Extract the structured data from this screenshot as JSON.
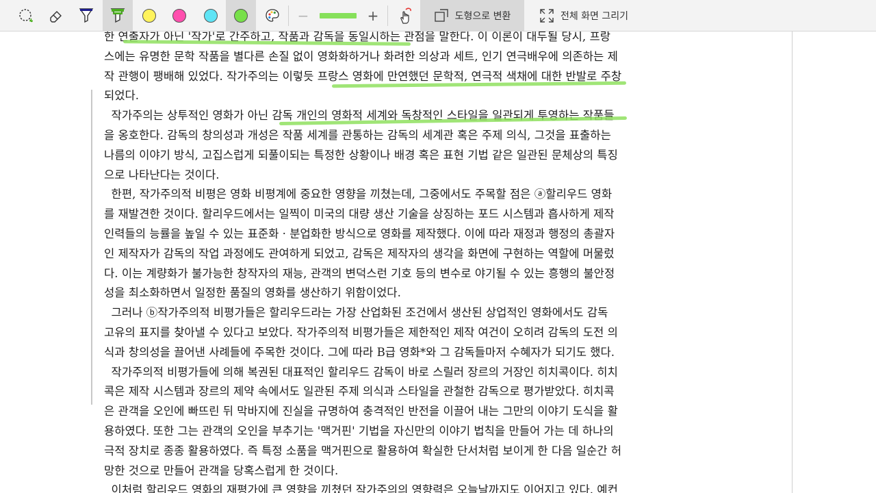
{
  "toolbar": {
    "tools": [
      {
        "name": "lasso-select-icon",
        "active": false
      },
      {
        "name": "eraser-icon",
        "active": false
      },
      {
        "name": "pen-icon",
        "color": "#1d1d8f",
        "active": false
      },
      {
        "name": "highlighter-icon",
        "color": "#4caf1f",
        "active": true
      }
    ],
    "swatches": [
      {
        "name": "yellow",
        "color": "#fff35c"
      },
      {
        "name": "pink",
        "color": "#ff4fae"
      },
      {
        "name": "cyan",
        "color": "#5fe4f5"
      },
      {
        "name": "green",
        "color": "#78e04a",
        "selected": true
      }
    ],
    "thickness_minus": "−",
    "thickness_plus": "+",
    "convert_to_shape_label": "도형으로 변환",
    "fullscreen_draw_label": "전체 화면 그리기"
  },
  "highlight_color": "#8fe05f",
  "document": {
    "lines": [
      "한 연출자가 아닌 '작가'로 간주하고, 작품과 감독을 동일시하는 관점을 말한다. 이 이론이 대두될 당시, 프랑",
      "스에는 유명한 문학 작품을 별다른 손질 없이 영화화하거나 화려한 의상과 세트, 인기 연극배우에 의존하는 제",
      "작 관행이 팽배해 있었다. 작가주의는 이렇듯 프랑스 영화에 만연했던 문학적, 연극적 색채에 대한 반발로 주창",
      "되었다.",
      "  작가주의는 상투적인 영화가 아닌 감독 개인의 영화적 세계와 독창적인 스타일을 일관되게 투영하는 작품들",
      "을 옹호한다. 감독의 창의성과 개성은 작품 세계를 관통하는 감독의 세계관 혹은 주제 의식, 그것을 표출하는",
      "나름의 이야기 방식, 고집스럽게 되풀이되는 특정한 상황이나 배경 혹은 표현 기법 같은 일관된 문체상의 특징",
      "으로 나타난다는 것이다.",
      "  한편, 작가주의적 비평은 영화 비평계에 중요한 영향을 끼쳤는데, 그중에서도 주목할 점은 ⓐ할리우드 영화",
      "를 재발견한 것이다. 할리우드에서는 일찍이 미국의 대량 생산 기술을 상징하는 포드 시스템과 흡사하게 제작",
      "인력들의 능률을 높일 수 있는 표준화 · 분업화한 방식으로 영화를 제작했다. 이에 따라 재정과 행정의 총괄자",
      "인 제작자가 감독의 작업 과정에도 관여하게 되었고, 감독은 제작자의 생각을 화면에 구현하는 역할에 머물렀",
      "다. 이는 계량화가 불가능한 창작자의 재능, 관객의 변덕스런 기호 등의 변수로 야기될 수 있는 흥행의 불안정",
      "성을 최소화하면서 일정한 품질의 영화를 생산하기 위함이었다.",
      "  그러나 ⓑ작가주의적 비평가들은 할리우드라는 가장 산업화된 조건에서 생산된 상업적인 영화에서도 감독",
      "고유의 표지를 찾아낼 수 있다고 보았다. 작가주의적 비평가들은 제한적인 제작 여건이 오히려 감독의 도전 의",
      "식과 창의성을 끌어낸 사례들에 주목한 것이다. 그에 따라 B급 영화*와 그 감독들마저 수혜자가 되기도 했다.",
      "  작가주의적 비평가들에 의해 복권된 대표적인 할리우드 감독이 바로 스릴러 장르의 거장인 히치콕이다. 히치",
      "콕은 제작 시스템과 장르의 제약 속에서도 일관된 주제 의식과 스타일을 관철한 감독으로 평가받았다. 히치콕",
      "은 관객을 오인에 빠뜨린 뒤 막바지에 진실을 규명하여 충격적인 반전을 이끌어 내는 그만의 이야기 도식을 활",
      "용하였다. 또한 그는 관객의 오인을 부추기는 '맥거핀' 기법을 자신만의 이야기 법칙을 만들어 가는 데 하나의",
      "극적 장치로 종종 활용하였다. 즉 특정 소품을 맥거핀으로 활용하여 확실한 단서처럼 보이게 한 다음 일순간 허",
      "망한 것으로 만들어 관객을 당혹스럽게 한 것이다.",
      "  이처럼 할리우드 영화의 재평가에 큰 영향을 끼쳤던 작가주의의 영향력은 오늘날까지도 이어지고 있다. 예컨"
    ]
  }
}
